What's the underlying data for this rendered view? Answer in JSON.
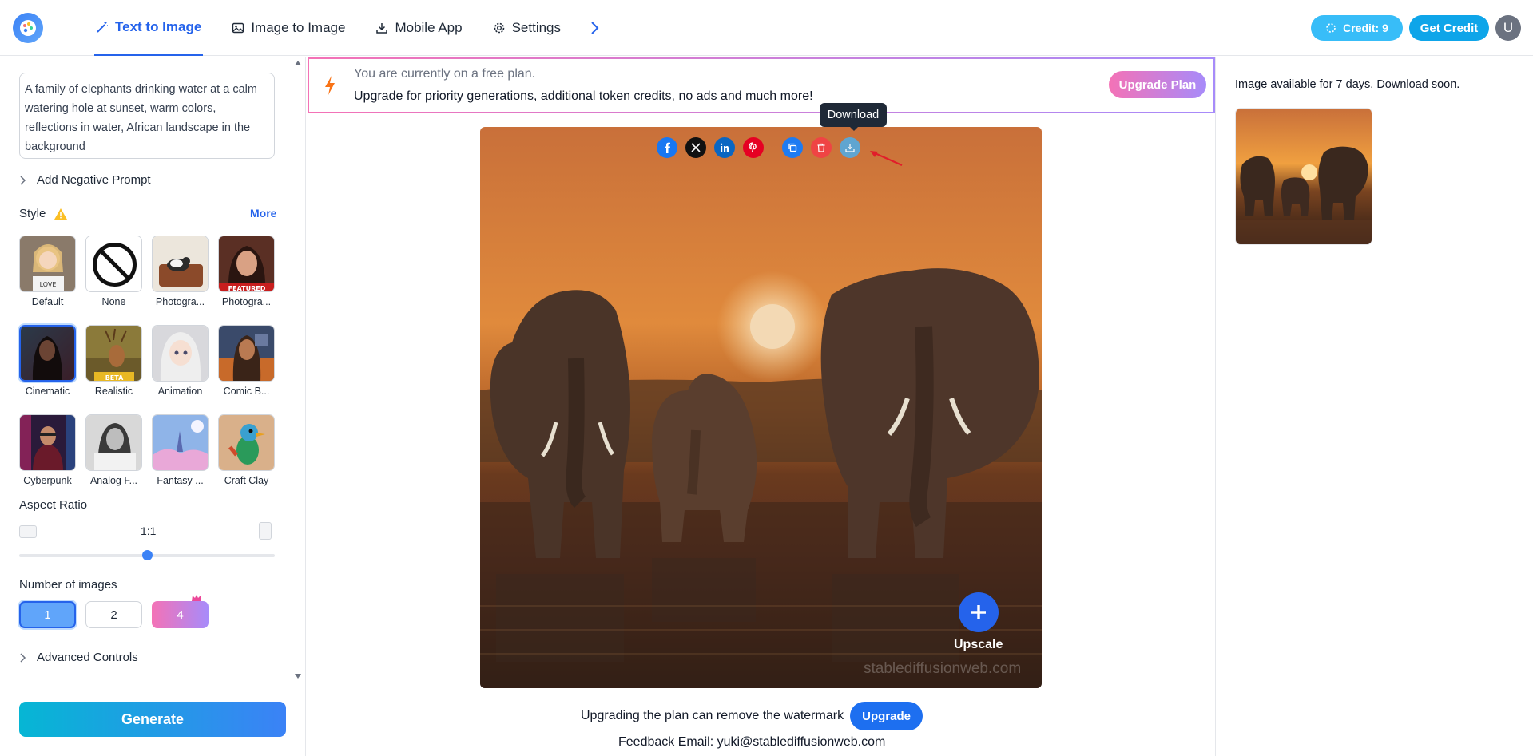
{
  "header": {
    "nav": [
      {
        "label": "Text to Image",
        "icon": "magic-wand-icon",
        "active": true
      },
      {
        "label": "Image to Image",
        "icon": "image-icon",
        "active": false
      },
      {
        "label": "Mobile App",
        "icon": "download-icon",
        "active": false
      },
      {
        "label": "Settings",
        "icon": "gear-icon",
        "active": false
      }
    ],
    "credit_label": "Credit: 9",
    "get_credit_label": "Get Credit",
    "avatar_letter": "U"
  },
  "sidebar": {
    "prompt": "A family of elephants drinking water at a calm watering hole at sunset, warm colors, reflections in water, African landscape in the background",
    "negative_prompt_label": "Add Negative Prompt",
    "style_title": "Style",
    "more_label": "More",
    "styles": [
      {
        "label": "Default",
        "selected": false
      },
      {
        "label": "None",
        "selected": false
      },
      {
        "label": "Photogra...",
        "selected": false
      },
      {
        "label": "Photogra...",
        "selected": false,
        "badge": "FEATURED"
      },
      {
        "label": "Cinematic",
        "selected": true
      },
      {
        "label": "Realistic",
        "selected": false,
        "badge": "BETA"
      },
      {
        "label": "Animation",
        "selected": false
      },
      {
        "label": "Comic B...",
        "selected": false
      },
      {
        "label": "Cyberpunk",
        "selected": false
      },
      {
        "label": "Analog F...",
        "selected": false
      },
      {
        "label": "Fantasy ...",
        "selected": false
      },
      {
        "label": "Craft Clay",
        "selected": false
      }
    ],
    "aspect_title": "Aspect Ratio",
    "aspect_value": "1:1",
    "aspect_slider_fraction": 0.5,
    "num_title": "Number of images",
    "num_options": [
      "1",
      "2",
      "4"
    ],
    "num_selected": "1",
    "advanced_label": "Advanced Controls",
    "generate_label": "Generate"
  },
  "banner": {
    "line1": "You are currently on a free plan.",
    "line2": "Upgrade for priority generations, additional token credits, no ads and much more!",
    "button": "Upgrade Plan"
  },
  "image_view": {
    "share_buttons": [
      "facebook-icon",
      "x-icon",
      "linkedin-icon",
      "pinterest-icon"
    ],
    "action_buttons": [
      "copy-icon",
      "delete-icon",
      "download-icon"
    ],
    "tooltip": "Download",
    "upscale_label": "Upscale",
    "watermark": "stablediffusionweb.com",
    "watermark_note": "Upgrading the plan can remove the watermark",
    "upgrade_label": "Upgrade",
    "feedback": "Feedback Email: yuki@stablediffusionweb.com"
  },
  "right_panel": {
    "availability": "Image available for 7 days. Download soon."
  },
  "colors": {
    "accent": "#2563eb",
    "credit_bg": "#38bdf8",
    "premium_gradient": [
      "#f472b6",
      "#a78bfa"
    ]
  }
}
